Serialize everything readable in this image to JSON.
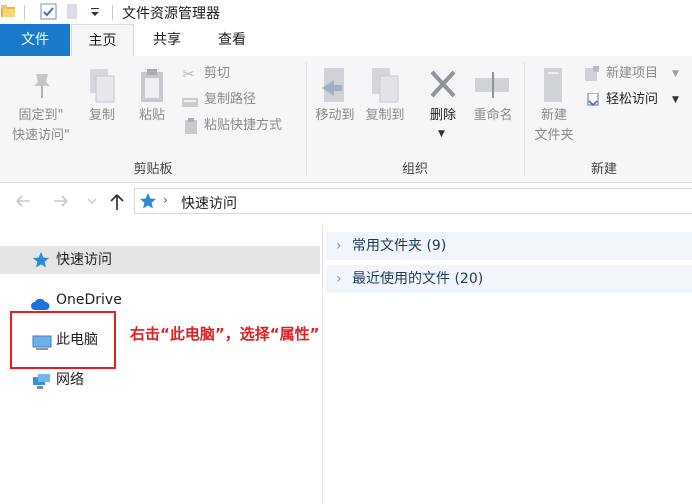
{
  "window": {
    "title": "文件资源管理器"
  },
  "tabs": {
    "file": "文件",
    "home": "主页",
    "share": "共享",
    "view": "查看"
  },
  "ribbon": {
    "clipboard": {
      "pin_line1": "固定到\"",
      "pin_line2": "快速访问\"",
      "copy": "复制",
      "paste": "粘贴",
      "cut": "剪切",
      "copy_path": "复制路径",
      "paste_shortcut": "粘贴快捷方式",
      "group_label": "剪贴板"
    },
    "organize": {
      "move_to": "移动到",
      "copy_to": "复制到",
      "delete": "删除",
      "rename": "重命名",
      "group_label": "组织"
    },
    "new": {
      "new_folder_line1": "新建",
      "new_folder_line2": "文件夹",
      "new_item": "新建项目",
      "easy_access": "轻松访问",
      "group_label": "新建"
    }
  },
  "address": {
    "path": "快速访问"
  },
  "nav_pane": {
    "quick_access": "快速访问",
    "onedrive": "OneDrive",
    "this_pc": "此电脑",
    "network": "网络"
  },
  "content": {
    "groups": [
      {
        "label": "常用文件夹 (9)"
      },
      {
        "label": "最近使用的文件 (20)"
      }
    ]
  },
  "annotation": {
    "text": "右击“此电脑”，选择“属性”"
  },
  "colors": {
    "accent": "#1979ca",
    "annotation": "#e02020"
  }
}
